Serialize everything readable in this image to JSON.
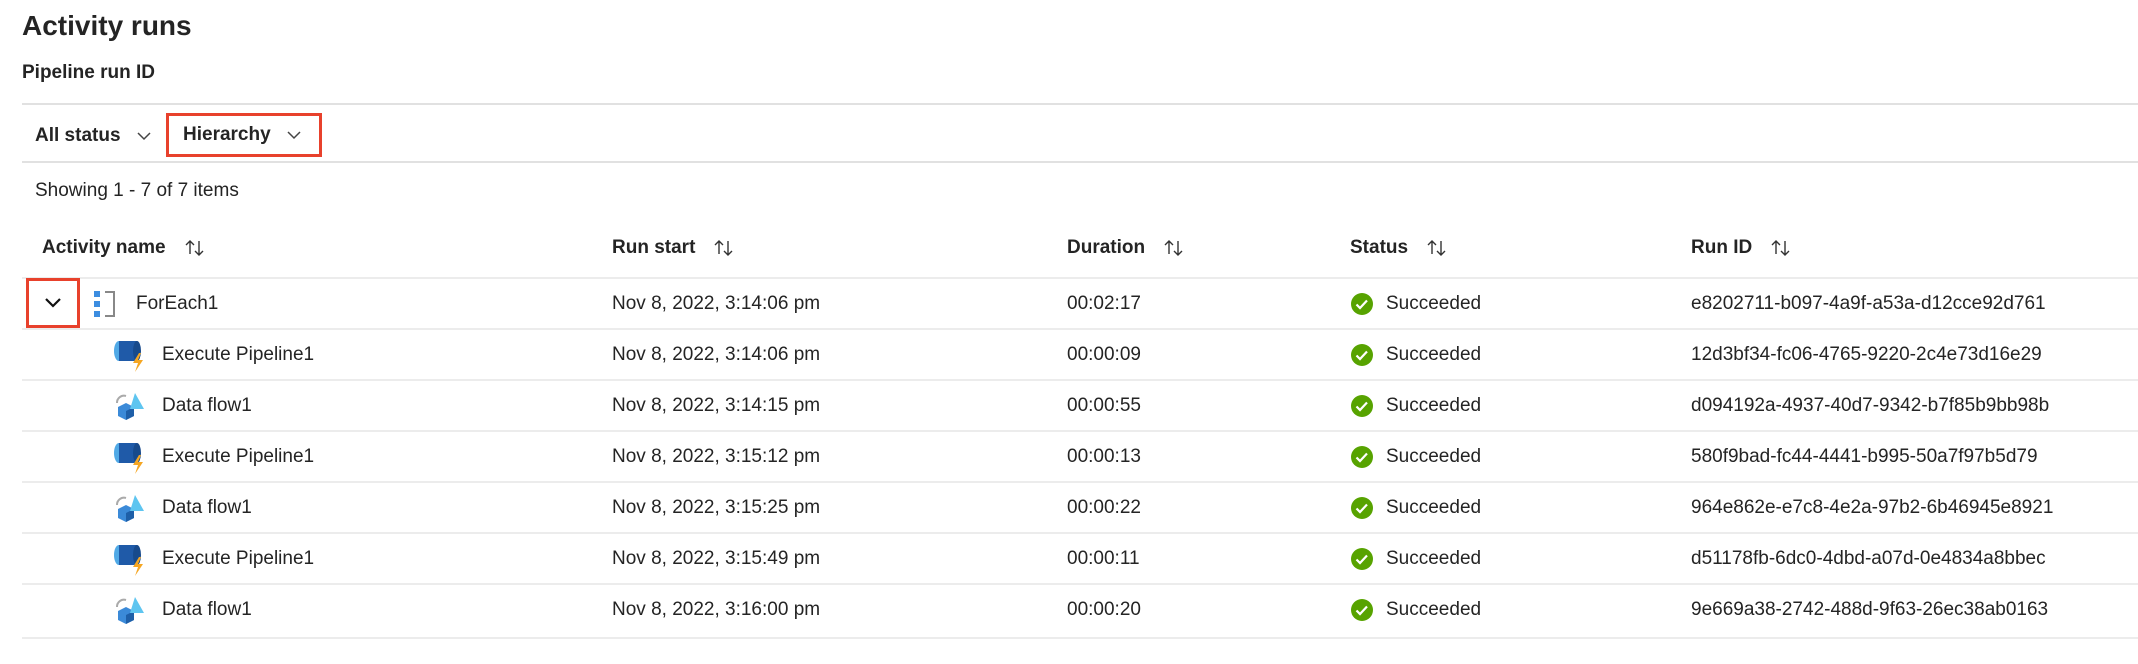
{
  "header": {
    "title": "Activity runs",
    "subtitle": "Pipeline run ID"
  },
  "filters": {
    "status": "All status",
    "view": "Hierarchy"
  },
  "showing": "Showing 1 - 7 of 7 items",
  "columns": [
    "Activity name",
    "Run start",
    "Duration",
    "Status",
    "Run ID"
  ],
  "colors": {
    "highlight": "#e8412c",
    "success": "#57a300"
  },
  "rows": [
    {
      "name": "ForEach1",
      "icon": "foreach-icon",
      "start": "Nov 8, 2022, 3:14:06 pm",
      "duration": "00:02:17",
      "status": "Succeeded",
      "id": "e8202711-b097-4a9f-a53a-d12cce92d761",
      "parent": true
    },
    {
      "name": "Execute Pipeline1",
      "icon": "execute-pipeline-icon",
      "start": "Nov 8, 2022, 3:14:06 pm",
      "duration": "00:00:09",
      "status": "Succeeded",
      "id": "12d3bf34-fc06-4765-9220-2c4e73d16e29"
    },
    {
      "name": "Data flow1",
      "icon": "data-flow-icon",
      "start": "Nov 8, 2022, 3:14:15 pm",
      "duration": "00:00:55",
      "status": "Succeeded",
      "id": "d094192a-4937-40d7-9342-b7f85b9bb98b"
    },
    {
      "name": "Execute Pipeline1",
      "icon": "execute-pipeline-icon",
      "start": "Nov 8, 2022, 3:15:12 pm",
      "duration": "00:00:13",
      "status": "Succeeded",
      "id": "580f9bad-fc44-4441-b995-50a7f97b5d79"
    },
    {
      "name": "Data flow1",
      "icon": "data-flow-icon",
      "start": "Nov 8, 2022, 3:15:25 pm",
      "duration": "00:00:22",
      "status": "Succeeded",
      "id": "964e862e-e7c8-4e2a-97b2-6b46945e8921"
    },
    {
      "name": "Execute Pipeline1",
      "icon": "execute-pipeline-icon",
      "start": "Nov 8, 2022, 3:15:49 pm",
      "duration": "00:00:11",
      "status": "Succeeded",
      "id": "d51178fb-6dc0-4dbd-a07d-0e4834a8bbec"
    },
    {
      "name": "Data flow1",
      "icon": "data-flow-icon",
      "start": "Nov 8, 2022, 3:16:00 pm",
      "duration": "00:00:20",
      "status": "Succeeded",
      "id": "9e669a38-2742-488d-9f63-26ec38ab0163"
    }
  ]
}
